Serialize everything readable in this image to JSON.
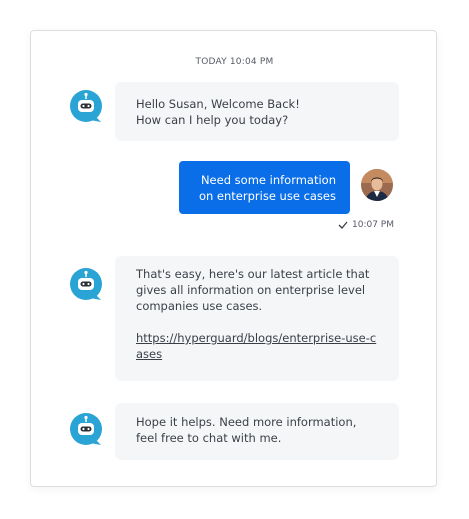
{
  "chat": {
    "timestamp": "TODAY 10:04 PM",
    "messages": [
      {
        "from": "bot",
        "text": "Hello Susan, Welcome Back!\nHow can I help you today?"
      },
      {
        "from": "user",
        "text": "Need some information on enterprise use cases",
        "time": "10:07 PM"
      },
      {
        "from": "bot",
        "text": "That's easy, here's our latest article that gives all information on enterprise level companies use cases.",
        "link": "https://hyperguard/blogs/enterprise-use-cases"
      },
      {
        "from": "bot",
        "text": "Hope it helps. Need more information, feel free to chat with me."
      }
    ]
  },
  "icons": {
    "bot": "robot-chat-icon",
    "check": "check-icon",
    "user": "user-avatar"
  },
  "colors": {
    "user_bubble": "#0a6ee8",
    "bot_icon": "#2aa4d4",
    "bot_bubble": "#f5f6f8"
  }
}
